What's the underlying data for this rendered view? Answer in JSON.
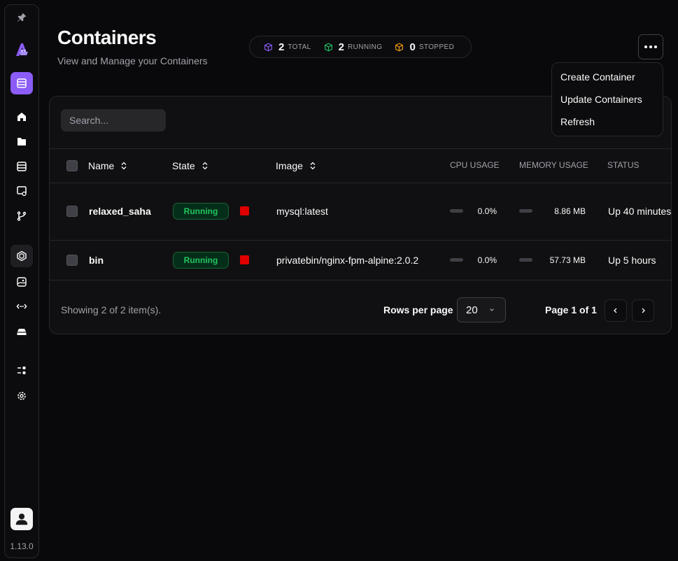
{
  "sidebar": {
    "items": [
      {
        "icon": "pin-icon"
      },
      {
        "icon": "logo-icon"
      },
      {
        "icon": "database-icon"
      },
      {
        "icon": "home-icon"
      },
      {
        "icon": "folder-icon"
      },
      {
        "icon": "server-icon"
      },
      {
        "icon": "server-settings-icon"
      },
      {
        "icon": "git-branch-icon"
      },
      {
        "icon": "container-icon"
      },
      {
        "icon": "image-icon"
      },
      {
        "icon": "network-icon"
      },
      {
        "icon": "drive-icon"
      },
      {
        "icon": "list-icon"
      },
      {
        "icon": "settings-icon"
      }
    ],
    "version": "1.13.0"
  },
  "header": {
    "title": "Containers",
    "subtitle": "View and Manage your Containers"
  },
  "stats": {
    "total_count": "2",
    "total_label": "TOTAL",
    "running_count": "2",
    "running_label": "RUNNING",
    "stopped_count": "0",
    "stopped_label": "STOPPED"
  },
  "colors": {
    "accent": "#8b5cf6",
    "running": "#22c55e",
    "stop": "#e00000",
    "stopped": "#f59e0b"
  },
  "search": {
    "placeholder": "Search..."
  },
  "table": {
    "columns": {
      "name": "Name",
      "state": "State",
      "image": "Image",
      "cpu": "CPU USAGE",
      "memory": "MEMORY USAGE",
      "status": "STATUS"
    },
    "rows": [
      {
        "name": "relaxed_saha",
        "state": "Running",
        "image": "mysql:latest",
        "cpu": "0.0%",
        "cpu_fraction": 0.0,
        "memory": "8.86 MB",
        "status": "Up 40 minutes"
      },
      {
        "name": "bin",
        "state": "Running",
        "image": "privatebin/nginx-fpm-alpine:2.0.2",
        "cpu": "0.0%",
        "cpu_fraction": 0.0,
        "memory": "57.73 MB",
        "status": "Up 5 hours"
      }
    ]
  },
  "footer": {
    "showing": "Showing 2 of 2 item(s).",
    "rows_per_page_label": "Rows per page",
    "rows_per_page_value": "20",
    "page_label": "Page 1 of 1"
  },
  "menu": {
    "items": [
      "Create Container",
      "Update Containers",
      "Refresh"
    ]
  }
}
